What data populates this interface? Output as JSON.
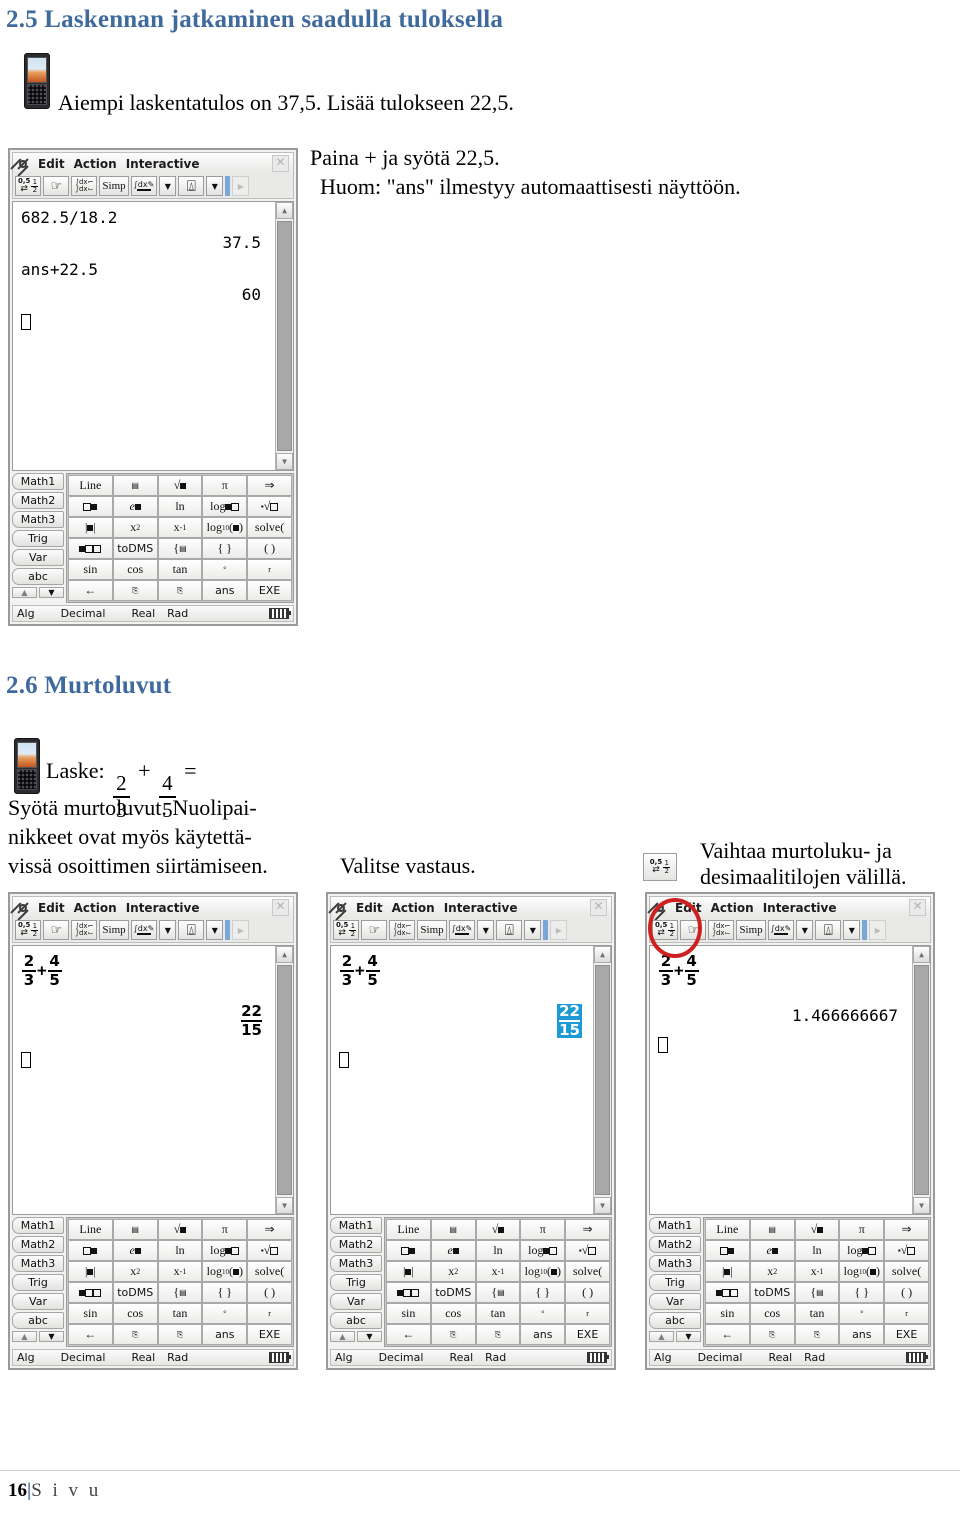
{
  "document": {
    "section_25": {
      "heading": "2.5 Laskennan jatkaminen saadulla tuloksella",
      "instruction": "Aiempi laskentatulos on 37,5. Lisää tulokseen 22,5.",
      "note_line1": "Paina + ja syötä 22,5.",
      "note_line2": "Huom: \"ans\" ilmestyy automaattisesti näyttöön."
    },
    "section_26": {
      "heading": "2.6 Murtoluvut",
      "task_label": "Laske:",
      "task_fraction": {
        "a_num": "2",
        "a_den": "3",
        "op": "+",
        "b_num": "4",
        "b_den": "5",
        "equals": "="
      },
      "caption_left_line1": "Syötä murtoluvut. Nuolipai-",
      "caption_left_line2": "nikkeet ovat myös käytettä-",
      "caption_left_line3": "vissä osoittimen siirtämiseen.",
      "caption_middle": "Valitse vastaus.",
      "caption_right_line1": "Vaihtaa murtoluku- ja",
      "caption_right_line2": "desimaalitilojen välillä."
    },
    "footer": {
      "page": "16",
      "separator": "|",
      "label": "S i v u"
    }
  },
  "calculator": {
    "menu": {
      "gear": "gear-icon",
      "items": [
        "Edit",
        "Action",
        "Interactive"
      ],
      "close": "✕"
    },
    "toolbar_buttons": [
      {
        "name": "fraction-decimal-toggle",
        "type": "frac-toggle"
      },
      {
        "name": "hand-pointer",
        "type": "hand"
      },
      {
        "name": "integral-transform",
        "type": "integral"
      },
      {
        "name": "simplify",
        "type": "text",
        "label": "Simp"
      },
      {
        "name": "integral-pen",
        "type": "pen"
      },
      {
        "name": "dropdown-1",
        "type": "tri"
      },
      {
        "name": "graph",
        "type": "graph"
      },
      {
        "name": "dropdown-2",
        "type": "tri"
      },
      {
        "name": "next-page",
        "type": "tri-right-disabled"
      }
    ],
    "keyboard": {
      "tabs": [
        "Math1",
        "Math2",
        "Math3",
        "Trig",
        "Var",
        "abc"
      ],
      "rows": [
        [
          "Line",
          "fraction-template",
          "sqrt-box",
          "π",
          "⇒"
        ],
        [
          "power-box",
          "e-power",
          "ln",
          "log-base",
          "nth-root"
        ],
        [
          "abs-box",
          "x²",
          "x⁻¹",
          "log₁₀",
          "solve("
        ],
        [
          "mixed-number",
          "toDMS",
          "{ piecewise",
          "{ }",
          "( )"
        ],
        [
          "sin",
          "cos",
          "tan",
          "°",
          "r"
        ],
        [
          "backspace",
          "copy",
          "paste",
          "ans",
          "EXE"
        ]
      ]
    },
    "status_bar": {
      "items": [
        "Alg",
        "Decimal",
        "Real",
        "Rad"
      ],
      "battery": "battery-icon"
    }
  },
  "screens": {
    "screen_25": {
      "line1": "682.5/18.2",
      "result1": "37.5",
      "line2": "ans+22.5",
      "result2": "60",
      "cursor": "▯"
    },
    "screen_26a": {
      "expr": {
        "a_num": "2",
        "a_den": "3",
        "op": "+",
        "b_num": "4",
        "b_den": "5"
      },
      "result": {
        "num": "22",
        "den": "15"
      },
      "selected": false
    },
    "screen_26b": {
      "expr": {
        "a_num": "2",
        "a_den": "3",
        "op": "+",
        "b_num": "4",
        "b_den": "5"
      },
      "result": {
        "num": "22",
        "den": "15"
      },
      "selected": true
    },
    "screen_26c": {
      "expr": {
        "a_num": "2",
        "a_den": "3",
        "op": "+",
        "b_num": "4",
        "b_den": "5"
      },
      "result_decimal": "1.466666667"
    }
  },
  "colors": {
    "heading": "#3f6a9e",
    "highlight_circle": "#cf2020",
    "selection": "#1b9ad6",
    "panel_bg": "#f2f2f0"
  }
}
